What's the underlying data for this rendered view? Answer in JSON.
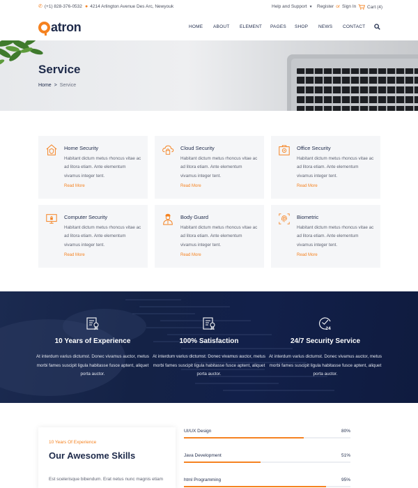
{
  "topbar": {
    "phone": "(+1) 828-376-0532",
    "address": "4214 Arlington Avenue Des Arc, Newyouk",
    "help": "Help and Support",
    "register": "Register",
    "or": "or",
    "signin": "Sign In",
    "cart": "Cart (4)"
  },
  "header": {
    "logo_text": "atron",
    "nav": [
      "HOME",
      "ABOUT",
      "ELEMENT",
      "PAGES",
      "SHOP",
      "NEWS",
      "CONTACT"
    ]
  },
  "hero": {
    "title": "Service",
    "breadcrumb": [
      "Home",
      ">",
      "Service"
    ]
  },
  "services": [
    {
      "title": "Home Security",
      "desc": "Habitant dictum metus rhoncus vitae ac ad litora etiam. Ante elementum vivamus integer tent.",
      "more": "Read More",
      "icon": "home-shield-icon"
    },
    {
      "title": "Cloud Security",
      "desc": "Habitant dictum metus rhoncus vitae ac ad litora etiam. Ante elementum vivamus integer tent.",
      "more": "Read More",
      "icon": "cloud-lock-icon"
    },
    {
      "title": "Office Security",
      "desc": "Habitant dictum metus rhoncus vitae ac ad litora etiam. Ante elementum vivamus integer tent.",
      "more": "Read More",
      "icon": "office-security-icon"
    },
    {
      "title": "Computer Security",
      "desc": "Habitant dictum metus rhoncus vitae ac ad litora etiam. Ante elementum vivamus integer tent.",
      "more": "Read More",
      "icon": "computer-lock-icon"
    },
    {
      "title": "Body Guard",
      "desc": "Habitant dictum metus rhoncus vitae ac ad litora etiam. Ante elementum vivamus integer tent.",
      "more": "Read More",
      "icon": "body-guard-icon"
    },
    {
      "title": "Biometric",
      "desc": "Habitant dictum metus rhoncus vitae ac ad litora etiam. Ante elementum vivamus integer tent.",
      "more": "Read More",
      "icon": "fingerprint-icon"
    }
  ],
  "stats": [
    {
      "title": "10 Years of Experience",
      "desc": "At interdum varius dictumst. Donec vivamus auctor, metus morbi fames suscipit ligula habitasse fusce aptent, aliquet porta auctor.",
      "icon": "certificate-icon"
    },
    {
      "title": "100% Satisfaction",
      "desc": "At interdum varius dictumst. Donec vivamus auctor, metus morbi fames suscipit ligula habitasse fusce aptent, aliquet porta auctor.",
      "icon": "certificate-icon"
    },
    {
      "title": "24/7 Security Service",
      "desc": "At interdum varius dictumst. Donec vivamus auctor, metus morbi fames suscipit ligula habitasse fusce aptent, aliquet porta auctor.",
      "icon": "clock-24-icon"
    }
  ],
  "skills_section": {
    "eyebrow": "10 Years Of Experience",
    "heading": "Our Awesome Skills",
    "text": "Est scelerisque bibendum. Erat netus nunc magnis etiam"
  },
  "skills": [
    {
      "name": "UI/UX Design",
      "percent": "80%",
      "value": 80
    },
    {
      "name": "Java Development",
      "percent": "51%",
      "value": 51
    },
    {
      "name": "html Programming",
      "percent": "95%",
      "value": 95
    }
  ],
  "colors": {
    "accent": "#f58220",
    "navy": "#1e2a4a",
    "band": "#142246",
    "card_bg": "#f5f6f8"
  }
}
